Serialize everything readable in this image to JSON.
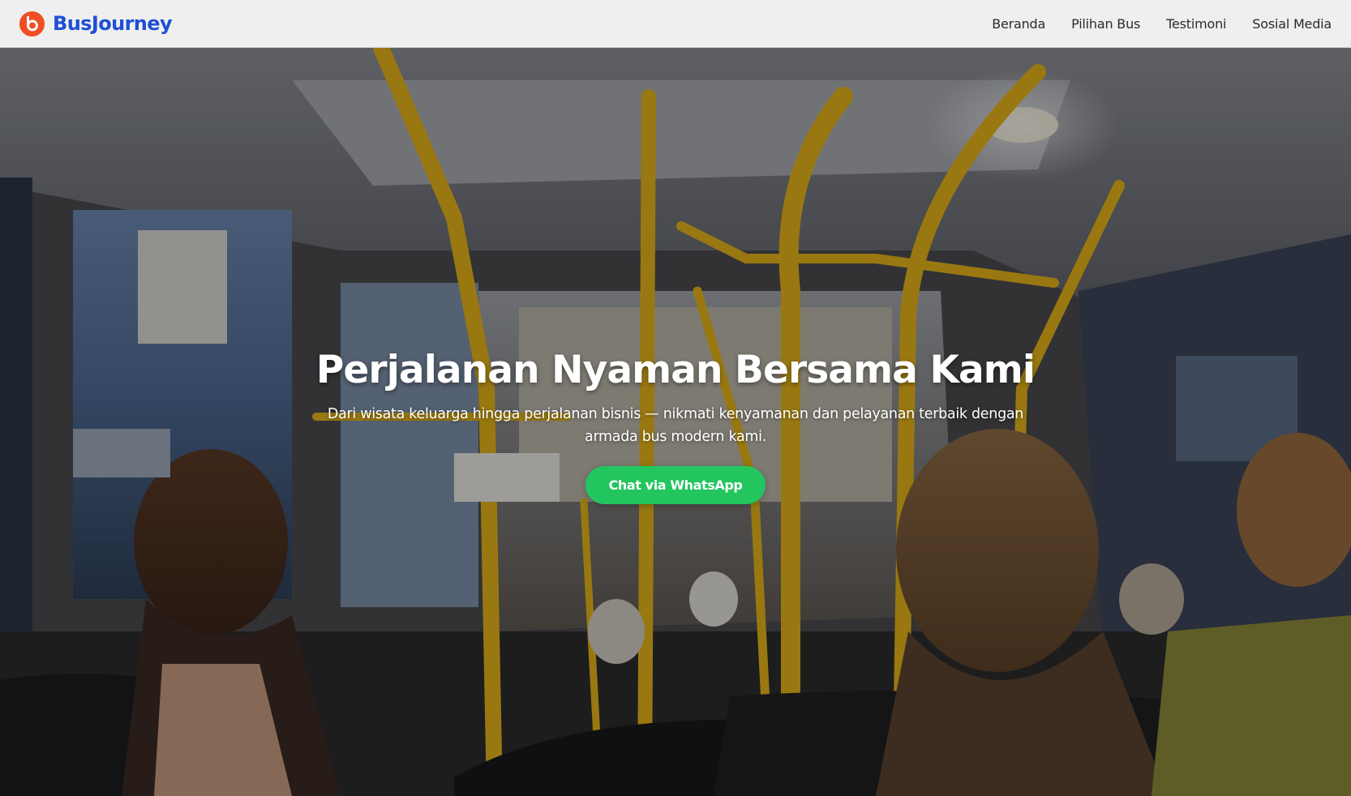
{
  "brand": {
    "name": "BusJourney",
    "icon": "brand-logo-icon",
    "color": "#1e4fd6",
    "icon_color": "#f04e23"
  },
  "nav": {
    "items": [
      {
        "label": "Beranda"
      },
      {
        "label": "Pilihan Bus"
      },
      {
        "label": "Testimoni"
      },
      {
        "label": "Sosial Media"
      }
    ]
  },
  "hero": {
    "title": "Perjalanan Nyaman Bersama Kami",
    "subtitle": "Dari wisata keluarga hingga perjalanan bisnis — nikmati kenyamanan dan pelayanan terbaik dengan armada bus modern kami.",
    "cta_label": "Chat via WhatsApp",
    "cta_color": "#22c55e",
    "background": "bus-interior-photo"
  }
}
